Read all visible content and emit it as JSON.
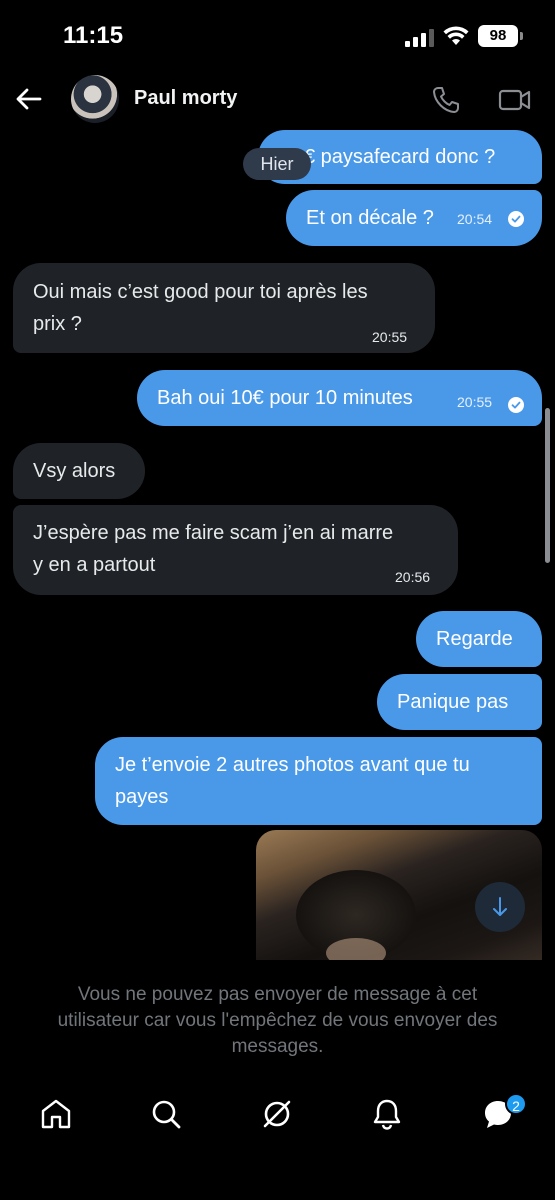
{
  "status_bar": {
    "time": "11:15",
    "battery": "98"
  },
  "header": {
    "contact_name": "Paul morty"
  },
  "thread": {
    "date_separator": "Hier",
    "messages": [
      {
        "direction": "out",
        "text": "€ paysafecard donc ?",
        "time": ""
      },
      {
        "direction": "out",
        "text": "Et on décale ?",
        "time": "20:54",
        "read": true
      },
      {
        "direction": "in",
        "lines": [
          "Oui mais c’est good pour toi après les",
          "prix ?"
        ],
        "time": "20:55"
      },
      {
        "direction": "out",
        "text": "Bah oui 10€ pour 10 minutes",
        "time": "20:55",
        "read": true
      },
      {
        "direction": "in",
        "text": "Vsy alors",
        "time": ""
      },
      {
        "direction": "in",
        "lines": [
          "J’espère pas me faire scam j’en ai marre",
          "y en a partout"
        ],
        "time": "20:56"
      },
      {
        "direction": "out",
        "text": "Regarde",
        "time": ""
      },
      {
        "direction": "out",
        "text": "Panique pas",
        "time": ""
      },
      {
        "direction": "out",
        "lines": [
          "Je t’envoie 2 autres photos avant que tu",
          "payes"
        ],
        "time": ""
      }
    ]
  },
  "notice": {
    "lines": [
      "Vous ne pouvez pas envoyer de message à cet",
      "utilisateur car vous l'empêchez de vous envoyer des",
      "messages."
    ]
  },
  "tab_bar": {
    "icons": [
      "home-icon",
      "search-icon",
      "grok-icon",
      "notifications-icon",
      "messages-icon"
    ],
    "messages_badge": "2"
  },
  "colors": {
    "outgoing_bubble": "#4a99e9",
    "incoming_bubble": "#1f2327",
    "accent": "#1d9bf0",
    "background": "#000000"
  }
}
